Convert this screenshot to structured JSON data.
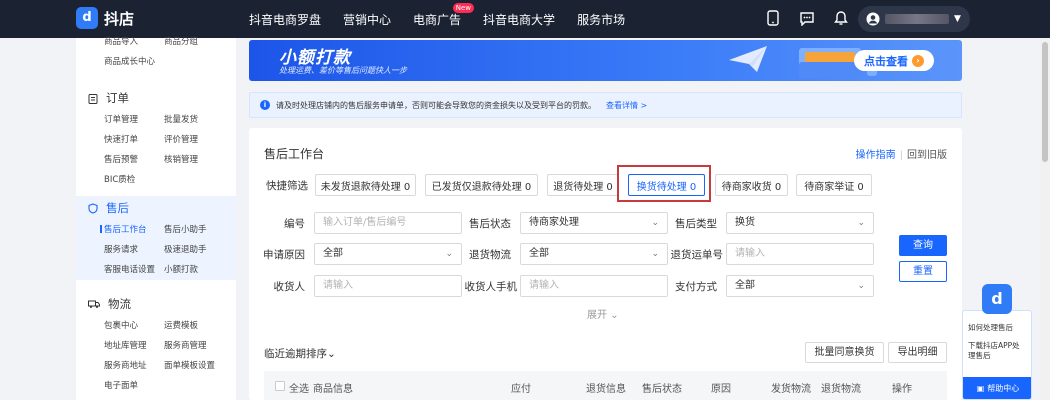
{
  "app": {
    "logo_text": "抖店"
  },
  "topnav": [
    {
      "label": "抖音电商罗盘"
    },
    {
      "label": "营销中心"
    },
    {
      "label": "电商广告",
      "badge": "New"
    },
    {
      "label": "抖音电商大学"
    },
    {
      "label": "服务市场"
    }
  ],
  "sidebar": {
    "top_links": [
      "商品导入",
      "商品分组",
      "商品成长中心"
    ],
    "orders": {
      "title": "订单",
      "links": [
        "订单管理",
        "批量发货",
        "快速打单",
        "评价管理",
        "售后预警",
        "核销管理",
        "BIC质检"
      ]
    },
    "aftersale": {
      "title": "售后",
      "links": [
        "售后工作台",
        "售后小助手",
        "服务请求",
        "极速退助手",
        "客服电话设置",
        "小额打款"
      ]
    },
    "logistics": {
      "title": "物流",
      "links": [
        "包裹中心",
        "运费模板",
        "地址库管理",
        "服务商管理",
        "服务商地址",
        "面单模板设置",
        "电子面单"
      ]
    }
  },
  "banner": {
    "title": "小额打款",
    "subtitle": "处理运费、差价等售后问题快人一步",
    "button": "点击查看"
  },
  "notice": {
    "text": "请及时处理店铺内的售后服务申请单，否则可能会导致您的资金损失以及受到平台的罚款。",
    "link": "查看详情 >"
  },
  "card": {
    "title": "售后工作台",
    "link_guide": "操作指南",
    "link_old": "回到旧版",
    "quick_label": "快捷筛选",
    "quick_filters": [
      "未发货退款待处理 0",
      "已发货仅退款待处理 0",
      "退货待处理 0",
      "换货待处理 0",
      "待商家收货 0",
      "待商家举证 0"
    ],
    "form": {
      "order_no_label": "编号",
      "order_no_ph": "输入订单/售后编号",
      "status_label": "售后状态",
      "status_value": "待商家处理",
      "type_label": "售后类型",
      "type_value": "换货",
      "reason_label": "申请原因",
      "reason_value": "全部",
      "logistics_label": "退货物流",
      "logistics_value": "全部",
      "tracking_label": "退货运单号",
      "tracking_ph": "请输入",
      "receiver_label": "收货人",
      "receiver_ph": "请输入",
      "phone_label": "收货人手机",
      "phone_ph": "请输入",
      "pay_label": "支付方式",
      "pay_value": "全部"
    },
    "query": "查询",
    "reset": "重置",
    "expand": "展开",
    "sort": "临近逾期排序",
    "batch_exchange": "批量同意换货",
    "export": "导出明细",
    "table_headers": [
      "全选",
      "商品信息",
      "应付",
      "退货信息",
      "售后状态",
      "原因",
      "发货物流",
      "退货物流",
      "操作"
    ]
  },
  "helper": {
    "items": [
      "如何处理售后",
      "下载抖店APP处理售后"
    ],
    "button": "帮助中心"
  }
}
